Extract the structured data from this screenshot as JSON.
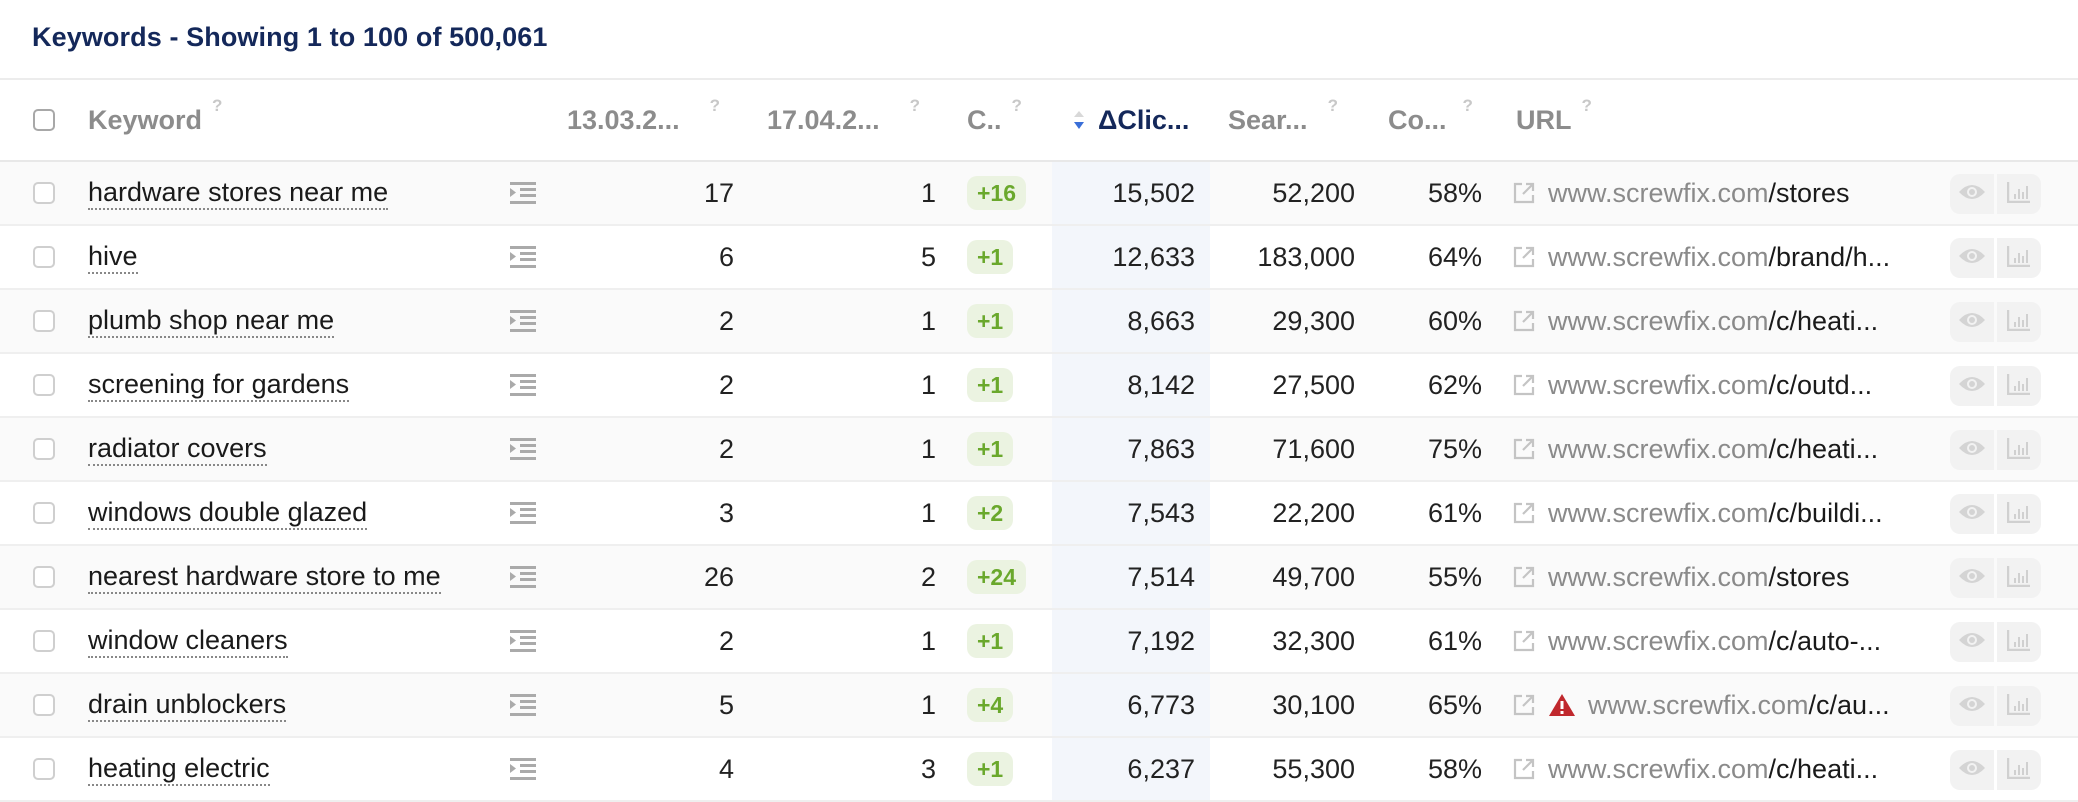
{
  "title": "Keywords - Showing 1 to 100 of 500,061",
  "columns": {
    "keyword": "Keyword",
    "date1": "13.03.2...",
    "date2": "17.04.2...",
    "change": "C..",
    "delta_clicks": "ΔClic...",
    "search_volume": "Sear...",
    "competition": "Co...",
    "url": "URL",
    "help": "?"
  },
  "sort": {
    "column": "delta_clicks",
    "direction": "descending"
  },
  "colors": {
    "title": "#14285a",
    "badge_text": "#6aa82c",
    "badge_bg": "#ebf3e1",
    "sorted_column_bg": "#f3f6fb",
    "warning": "#c0282d",
    "sort_active": "#3a6fd8"
  },
  "rows": [
    {
      "keyword": "hardware stores near me",
      "date1": "17",
      "date2": "1",
      "change": "+16",
      "delta_clicks": "15,502",
      "search_volume": "52,200",
      "competition": "58%",
      "url_host": "www.screwfix.com",
      "url_path": "/stores",
      "warning": false
    },
    {
      "keyword": "hive",
      "date1": "6",
      "date2": "5",
      "change": "+1",
      "delta_clicks": "12,633",
      "search_volume": "183,000",
      "competition": "64%",
      "url_host": "www.screwfix.com",
      "url_path": "/brand/h...",
      "warning": false
    },
    {
      "keyword": "plumb shop near me",
      "date1": "2",
      "date2": "1",
      "change": "+1",
      "delta_clicks": "8,663",
      "search_volume": "29,300",
      "competition": "60%",
      "url_host": "www.screwfix.com",
      "url_path": "/c/heati...",
      "warning": false
    },
    {
      "keyword": "screening for gardens",
      "date1": "2",
      "date2": "1",
      "change": "+1",
      "delta_clicks": "8,142",
      "search_volume": "27,500",
      "competition": "62%",
      "url_host": "www.screwfix.com",
      "url_path": "/c/outd...",
      "warning": false
    },
    {
      "keyword": "radiator covers",
      "date1": "2",
      "date2": "1",
      "change": "+1",
      "delta_clicks": "7,863",
      "search_volume": "71,600",
      "competition": "75%",
      "url_host": "www.screwfix.com",
      "url_path": "/c/heati...",
      "warning": false
    },
    {
      "keyword": "windows double glazed",
      "date1": "3",
      "date2": "1",
      "change": "+2",
      "delta_clicks": "7,543",
      "search_volume": "22,200",
      "competition": "61%",
      "url_host": "www.screwfix.com",
      "url_path": "/c/buildi...",
      "warning": false
    },
    {
      "keyword": "nearest hardware store to me",
      "date1": "26",
      "date2": "2",
      "change": "+24",
      "delta_clicks": "7,514",
      "search_volume": "49,700",
      "competition": "55%",
      "url_host": "www.screwfix.com",
      "url_path": "/stores",
      "warning": false
    },
    {
      "keyword": "window cleaners",
      "date1": "2",
      "date2": "1",
      "change": "+1",
      "delta_clicks": "7,192",
      "search_volume": "32,300",
      "competition": "61%",
      "url_host": "www.screwfix.com",
      "url_path": "/c/auto-...",
      "warning": false
    },
    {
      "keyword": "drain unblockers",
      "date1": "5",
      "date2": "1",
      "change": "+4",
      "delta_clicks": "6,773",
      "search_volume": "30,100",
      "competition": "65%",
      "url_host": "www.screwfix.com",
      "url_path": "/c/au...",
      "warning": true
    },
    {
      "keyword": "heating electric",
      "date1": "4",
      "date2": "3",
      "change": "+1",
      "delta_clicks": "6,237",
      "search_volume": "55,300",
      "competition": "58%",
      "url_host": "www.screwfix.com",
      "url_path": "/c/heati...",
      "warning": false
    }
  ],
  "icons": {
    "serp": "serp-list-icon",
    "external_link": "external-link-icon",
    "warning": "warning-icon",
    "eye": "eye-icon",
    "chart": "bar-chart-icon"
  }
}
